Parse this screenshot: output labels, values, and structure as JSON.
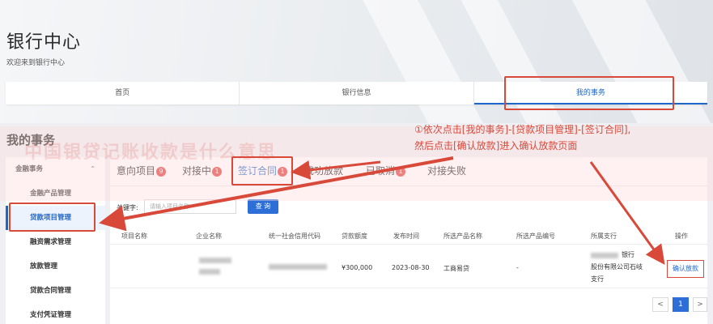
{
  "header": {
    "title": "银行中心",
    "subtitle": "欢迎来到银行中心"
  },
  "nav": {
    "items": [
      {
        "label": "首页"
      },
      {
        "label": "银行信息"
      },
      {
        "label": "我的事务"
      }
    ]
  },
  "section_title": "我的事务",
  "sidebar": {
    "group_label": "金融事务",
    "items": [
      {
        "label": "金融产品管理"
      },
      {
        "label": "贷款项目管理"
      },
      {
        "label": "融资需求管理"
      },
      {
        "label": "放款管理"
      },
      {
        "label": "贷款合同管理"
      },
      {
        "label": "支付凭证管理"
      }
    ]
  },
  "tabs": [
    {
      "label": "意向项目",
      "badge": "9"
    },
    {
      "label": "对接中",
      "badge": "1"
    },
    {
      "label": "签订合同",
      "badge": "1"
    },
    {
      "label": "成功放款",
      "badge": ""
    },
    {
      "label": "已取消",
      "badge": "1"
    },
    {
      "label": "对接失败",
      "badge": ""
    }
  ],
  "search": {
    "label": "关键字:",
    "placeholder": "请输入项目名称",
    "button_label": "查 询"
  },
  "table": {
    "headers": [
      "项目名称",
      "企业名称",
      "统一社会信用代码",
      "贷款额度",
      "发布时间",
      "所选产品名称",
      "所选产品编号",
      "所属支行",
      "操作"
    ],
    "rows": [
      {
        "project_name": "",
        "amount": "¥300,000",
        "publish_date": "2023-08-30",
        "product_name": "工商易贷",
        "product_code": "-",
        "branch_line1": "银行",
        "branch_line2": "股份有限公司石岐",
        "branch_line3": "支行",
        "action_label": "确认放款"
      }
    ]
  },
  "pagination": {
    "prev": "<",
    "current": "1",
    "next": ">"
  },
  "annotation": {
    "line1": "①依次点击[我的事务]-[贷款项目管理]-[签订合同],",
    "line2": "然后点击[确认放款]进入确认放款页面"
  },
  "watermark": "中国银贷记账收款是什么意思",
  "colors": {
    "primary": "#1e66c9",
    "annotation_red": "#d8493a",
    "badge_red": "#e03b3b"
  }
}
